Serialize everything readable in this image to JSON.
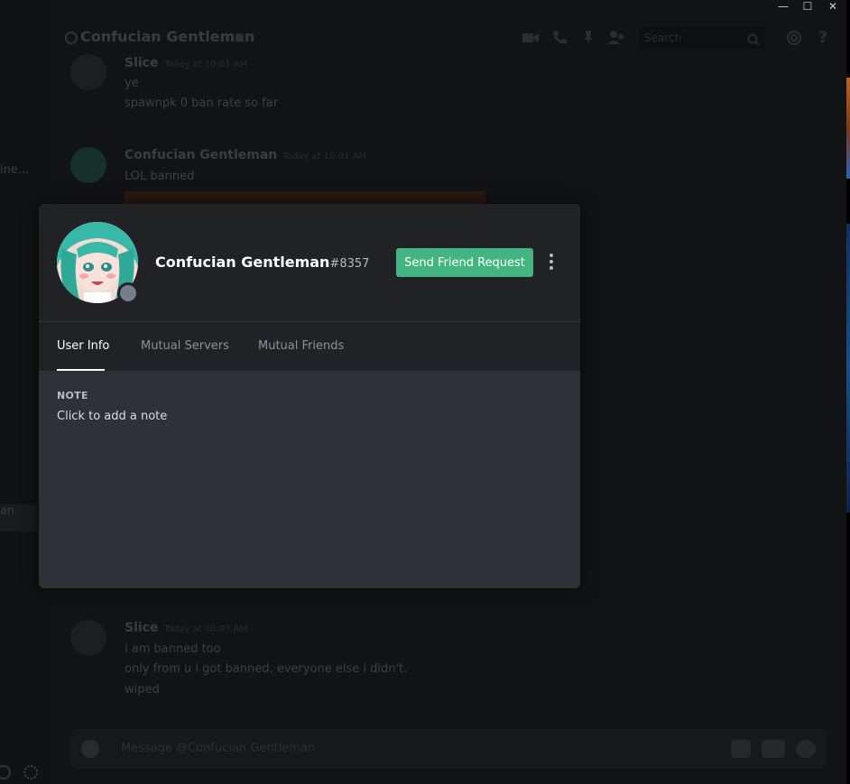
{
  "window": {
    "minimize": "—",
    "maximize": "☐",
    "close": "✕"
  },
  "sidebar": {
    "partial_text_1": "ine...",
    "partial_text_2": "an"
  },
  "header": {
    "title": "Confucian Gentleman",
    "search_placeholder": "Search",
    "icons": [
      "video-icon",
      "phone-icon",
      "pin-icon",
      "add-friend-icon",
      "search-icon",
      "mention-icon",
      "help-icon"
    ]
  },
  "messages": [
    {
      "author": "Slice",
      "time": "Today at 10:01 AM",
      "lines": [
        "ye",
        "spawnpk 0 ban rate so far"
      ]
    },
    {
      "author": "Confucian Gentleman",
      "time": "Today at 10:01 AM",
      "lines": [
        "LOL banned"
      ]
    },
    {
      "author": "Slice",
      "time": "Today at 10:07 AM",
      "lines": [
        "i am banned too",
        "only from u i got banned, everyone else i didn't.",
        "wiped"
      ]
    }
  ],
  "composer": {
    "placeholder": "Message @Confucian Gentleman",
    "icons": [
      "add-attachment-icon",
      "gift-icon",
      "gif-icon",
      "emoji-icon"
    ]
  },
  "profile": {
    "username": "Confucian Gentleman",
    "discriminator": "#8357",
    "status": "offline",
    "send_friend_request": "Send Friend Request",
    "tabs": [
      {
        "label": "User Info",
        "active": true
      },
      {
        "label": "Mutual Servers",
        "active": false
      },
      {
        "label": "Mutual Friends",
        "active": false
      }
    ],
    "note_label": "NOTE",
    "note_placeholder": "Click to add a note"
  },
  "colors": {
    "accent_green": "#43b581",
    "modal_header": "#202225",
    "modal_body": "#2f3136",
    "offline_gray": "#747f8d"
  }
}
